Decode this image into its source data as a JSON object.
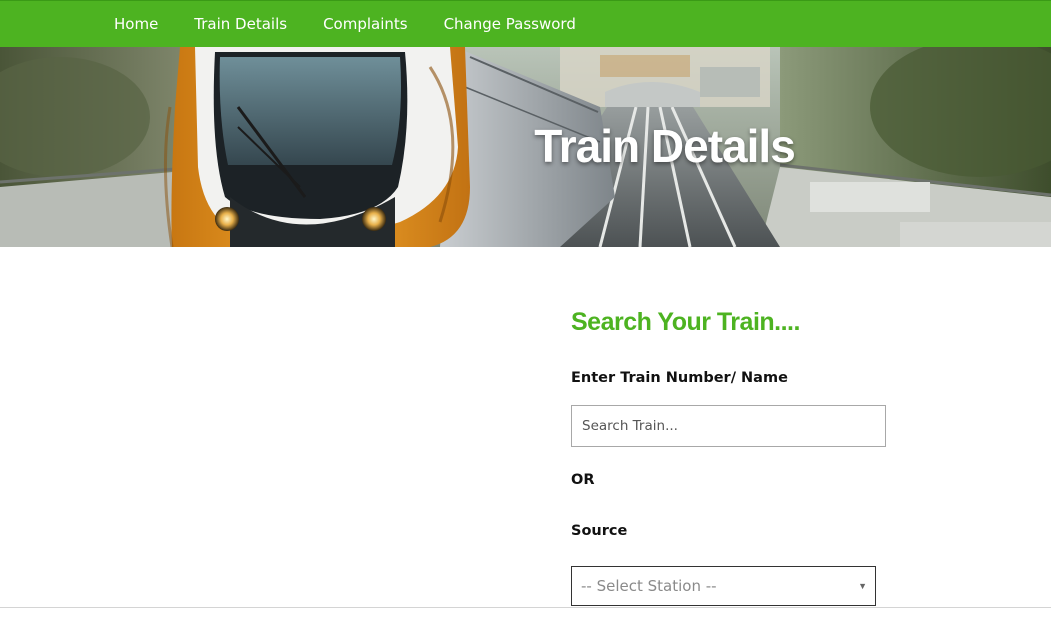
{
  "nav": {
    "items": [
      {
        "label": "Home"
      },
      {
        "label": "Train Details"
      },
      {
        "label": "Complaints"
      },
      {
        "label": "Change Password"
      }
    ]
  },
  "hero": {
    "title": "Train Details"
  },
  "search": {
    "heading": "Search Your Train....",
    "train_label": "Enter Train Number/ Name",
    "train_placeholder": "Search Train...",
    "or_label": "OR",
    "source_label": "Source",
    "source_selected": "-- Select Station --",
    "dropdown_icon": "triangle-down-icon"
  },
  "colors": {
    "accent_green": "#4db321",
    "train_orange": "#e39a21",
    "text_dark": "#111111"
  }
}
